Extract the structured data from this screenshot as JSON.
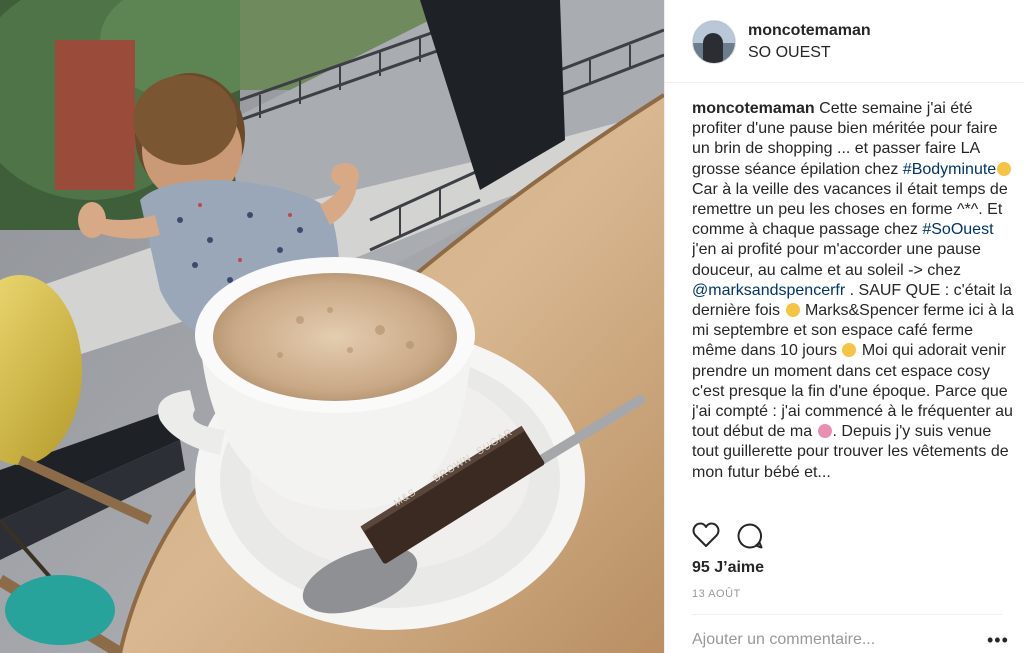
{
  "post": {
    "username": "moncotemaman",
    "location": "SO OUEST",
    "caption": {
      "username": "moncotemaman",
      "t1": " Cette semaine j'ai été profiter d'une pause bien méritée pour faire un brin de shopping ... et passer faire LA grosse séance épilation chez ",
      "h1": "#Bodyminute",
      "t2": "Car à la veille des vacances il était temps de remettre un peu les choses en forme ^*^. Et comme à chaque passage chez ",
      "h2": "#SoOuest",
      "t3": " j'en ai profité pour m'accorder une pause douceur, au calme et au soleil -> chez ",
      "h3": "@marksandspencerfr",
      "t4": " . SAUF QUE : c'était la dernière fois ",
      "t5": " Marks&Spencer ferme ici à la mi septembre et son espace café ferme même dans 10 jours ",
      "t6": " Moi qui adorait venir prendre un moment dans cet espace cosy c'est presque la fin d'une époque. Parce que j'ai compté : j'ai commencé à le fréquenter au tout début de ma ",
      "t7": ". Depuis j'y suis venue tout guillerette pour trouver les vêtements de mon futur",
      "t8": "bébé et..."
    },
    "likes": "95 J’aime",
    "date": "13 AOÛT",
    "comment_placeholder": "Ajouter un commentaire...",
    "more_label": "•••",
    "photo_texts": {
      "sachet_brand": "M&S",
      "sachet_line1": "BROWN",
      "sachet_line2": "SUGAR"
    }
  },
  "colors": {
    "text": "#262626",
    "hashtag": "#003569",
    "muted": "#999999",
    "border": "#efefef"
  },
  "icons": [
    "heart-icon",
    "comment-icon",
    "more-options-icon"
  ]
}
